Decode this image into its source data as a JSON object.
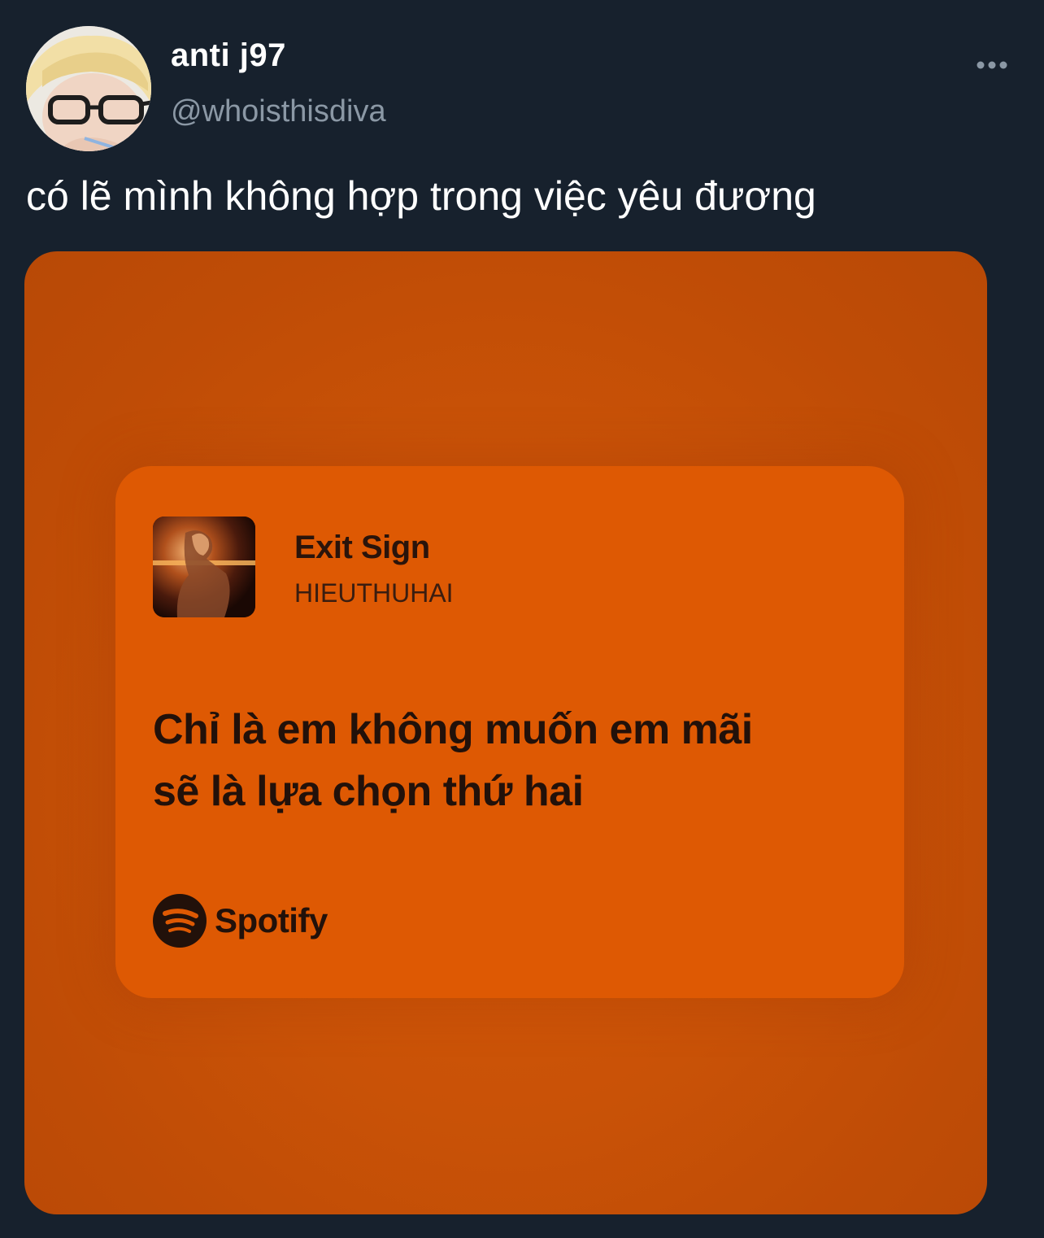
{
  "tweet": {
    "author": {
      "display_name": "anti j97",
      "handle": "@whoisthisdiva"
    },
    "more_icon": "more-horizontal-icon",
    "text": "có lẽ mình không hợp trong việc yêu đương"
  },
  "media": {
    "song_title": "Exit Sign",
    "artist": "HIEUTHUHAI",
    "lyrics": [
      "Chỉ là em không muốn em mãi",
      "sẽ là lựa chọn thứ hai"
    ],
    "brand": "Spotify",
    "brand_icon": "spotify-logo-icon",
    "colors": {
      "background": "#c95207",
      "card": "#de5903",
      "text": "#22110a"
    }
  },
  "colors": {
    "page_background": "#17212d",
    "primary_text": "#ffffff",
    "secondary_text": "#8b98a5"
  }
}
